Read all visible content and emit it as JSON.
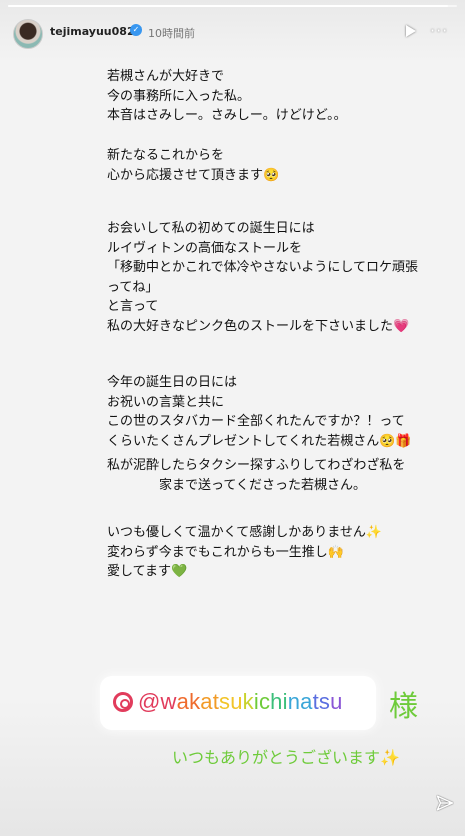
{
  "story": {
    "progress": 0.98,
    "username": "tejimayuu0827",
    "verified_mark": "✓",
    "timestamp": "10時間前",
    "icons": {
      "play": "play-icon",
      "more": "more-dots-icon",
      "send": "send-icon",
      "verified": "verified-badge-icon"
    }
  },
  "text": {
    "p1": "若槻さんが大好きで\n今の事務所に入った私。\n本音はさみしー。さみしー。けどけど。。",
    "p2": "新たなるこれからを\n心から応援させて頂きます🥺",
    "p3": "お会いして私の初めての誕生日には\nルイヴィトンの高価なストールを\n「移動中とかこれで体冷やさないようにしてロケ頑張\nってね」\nと言って\n私の大好きなピンク色のストールを下さいました💗",
    "p4": "今年の誕生日の日には\nお祝いの言葉と共に\nこの世のスタバカード全部くれたんですか？！って\nくらいたくさんプレゼントしてくれた若槻さん🥺🎁",
    "p5": "私が泥酔したらタクシー探すふりしてわざわざ私を\n　　　　家まで送ってくださった若槻さん。",
    "p6": "いつも優しくて温かくて感謝しかありません✨\n変わらず今までもこれからも一生推し🙌\n愛してます💚"
  },
  "mention": {
    "text": "@wakatsukichinatsu",
    "suffix": "様",
    "thanks": "いつもありがとうございます✨",
    "colors": [
      "#e13c5c",
      "#ef6b2d",
      "#f29b27",
      "#f2c428",
      "#c9d32e",
      "#6ecb3a",
      "#3bbf7a",
      "#3aa6d8",
      "#5b6fe0",
      "#8a55d6"
    ]
  }
}
